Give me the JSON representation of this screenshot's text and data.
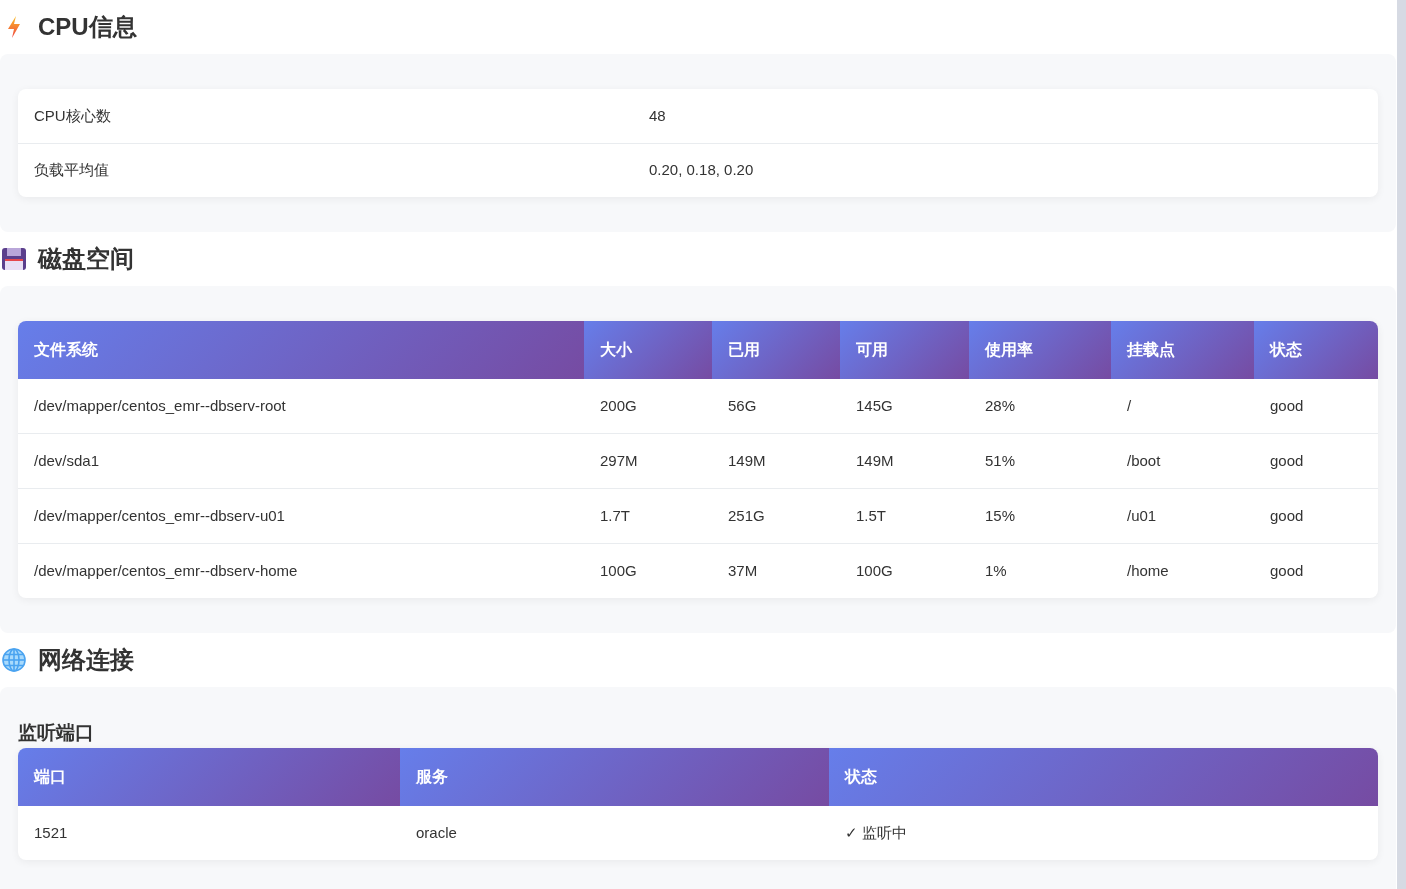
{
  "sections": [
    {
      "kind": "cpu",
      "title": "CPU信息",
      "rows": [
        {
          "label": "CPU核心数",
          "value": "48"
        },
        {
          "label": "负载平均值",
          "value": "0.20, 0.18, 0.20"
        }
      ]
    },
    {
      "kind": "disk",
      "title": "磁盘空间",
      "table": {
        "columns": [
          "文件系统",
          "大小",
          "已用",
          "可用",
          "使用率",
          "挂载点",
          "状态"
        ],
        "rows": [
          [
            "/dev/mapper/centos_emr--dbserv-root",
            "200G",
            "56G",
            "145G",
            "28%",
            "/",
            "good"
          ],
          [
            "/dev/sda1",
            "297M",
            "149M",
            "149M",
            "51%",
            "/boot",
            "good"
          ],
          [
            "/dev/mapper/centos_emr--dbserv-u01",
            "1.7T",
            "251G",
            "1.5T",
            "15%",
            "/u01",
            "good"
          ],
          [
            "/dev/mapper/centos_emr--dbserv-home",
            "100G",
            "37M",
            "100G",
            "1%",
            "/home",
            "good"
          ]
        ]
      }
    },
    {
      "kind": "network",
      "title": "网络连接",
      "subtitle": "监听端口",
      "table": {
        "columns": [
          "端口",
          "服务",
          "状态"
        ],
        "rows": [
          [
            "1521",
            "oracle",
            "✓ 监听中"
          ]
        ]
      }
    }
  ]
}
